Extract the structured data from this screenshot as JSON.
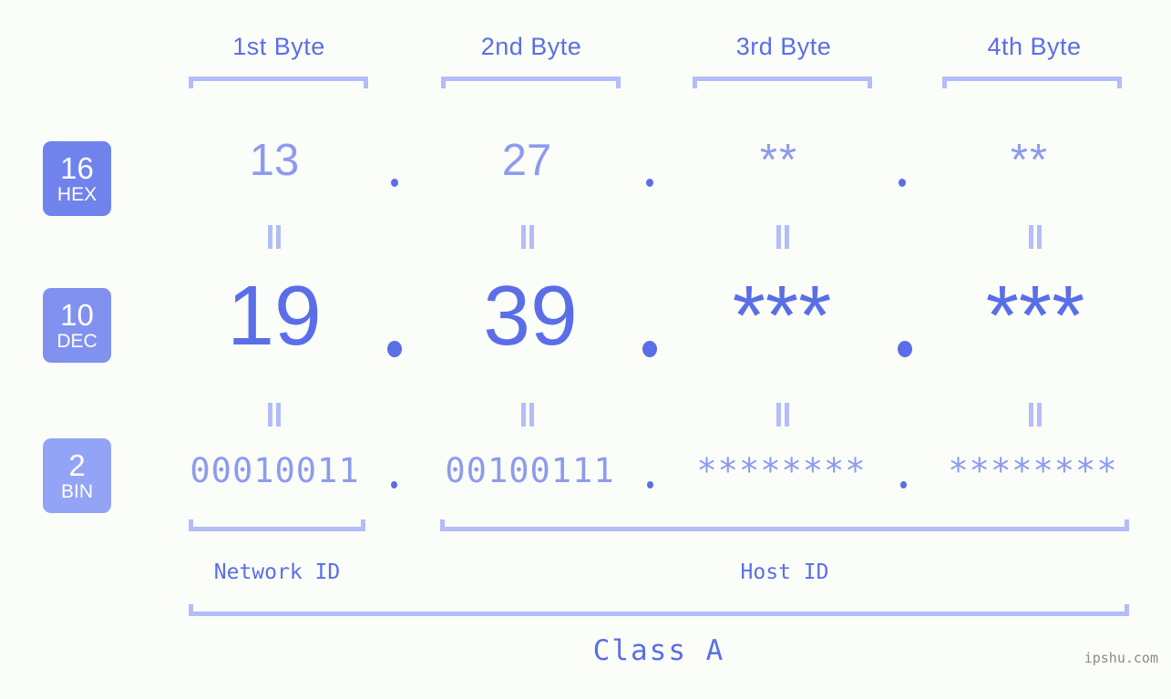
{
  "theme": {
    "background": "#fbfdf8",
    "accent_strong": "#5a6ee8",
    "accent_light": "#8c9bf0",
    "accent_bracket": "#b3bdf9",
    "badge_hex": "#7083ed",
    "badge_dec": "#8191ef",
    "badge_bin": "#93a3f5",
    "watermark_color": "#8a8a8a"
  },
  "byte_headers": [
    {
      "label": "1st Byte"
    },
    {
      "label": "2nd Byte"
    },
    {
      "label": "3rd Byte"
    },
    {
      "label": "4th Byte"
    }
  ],
  "bases": [
    {
      "radix": "16",
      "name": "HEX"
    },
    {
      "radix": "10",
      "name": "DEC"
    },
    {
      "radix": "2",
      "name": "BIN"
    }
  ],
  "rows": {
    "hex": {
      "values": [
        "13",
        "27",
        "**",
        "**"
      ],
      "separator": "."
    },
    "dec": {
      "values": [
        "19",
        "39",
        "***",
        "***"
      ],
      "separator": "."
    },
    "bin": {
      "values": [
        "00010011",
        "00100111",
        "********",
        "********"
      ],
      "separator": "."
    }
  },
  "equals_marks": {
    "symbol": "=",
    "count_per_row": 4,
    "rows": 2
  },
  "segments": {
    "network_id": "Network ID",
    "host_id": "Host ID",
    "class": "Class A"
  },
  "watermark": "ipshu.com"
}
